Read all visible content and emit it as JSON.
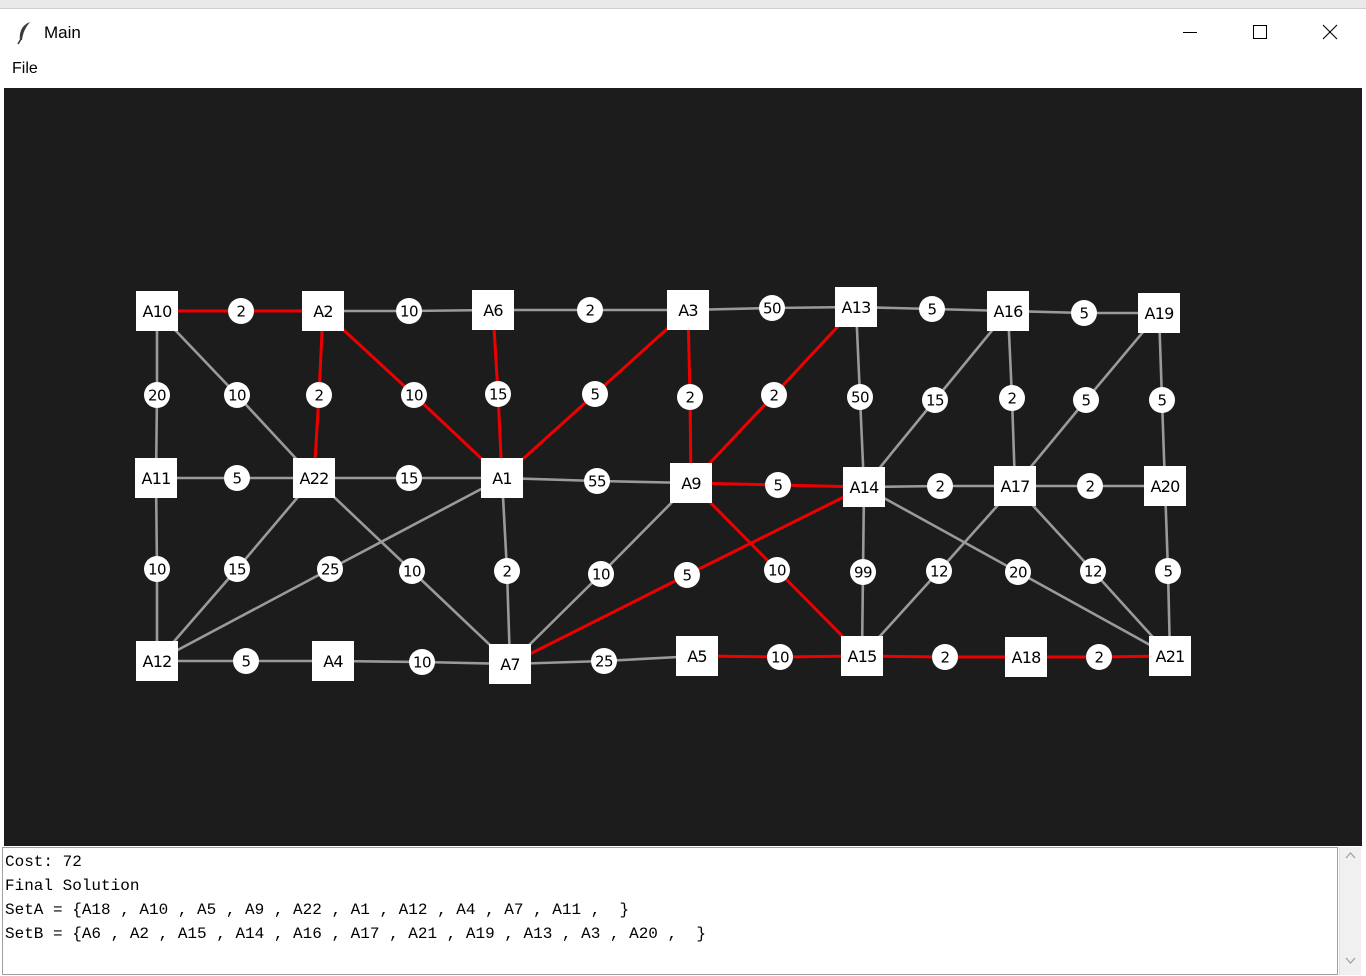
{
  "window": {
    "title": "Main"
  },
  "menu": {
    "file": "File"
  },
  "graph": {
    "nodes": [
      {
        "id": "A10"
      },
      {
        "id": "A2"
      },
      {
        "id": "A6"
      },
      {
        "id": "A3"
      },
      {
        "id": "A13"
      },
      {
        "id": "A16"
      },
      {
        "id": "A19"
      },
      {
        "id": "A11"
      },
      {
        "id": "A22"
      },
      {
        "id": "A1"
      },
      {
        "id": "A9"
      },
      {
        "id": "A14"
      },
      {
        "id": "A17"
      },
      {
        "id": "A20"
      },
      {
        "id": "A12"
      },
      {
        "id": "A4"
      },
      {
        "id": "A7"
      },
      {
        "id": "A5"
      },
      {
        "id": "A15"
      },
      {
        "id": "A18"
      },
      {
        "id": "A21"
      }
    ],
    "edges": [
      {
        "from": "A10",
        "to": "A2",
        "w": "2",
        "cut": true
      },
      {
        "from": "A2",
        "to": "A6",
        "w": "10",
        "cut": false
      },
      {
        "from": "A6",
        "to": "A3",
        "w": "2",
        "cut": false
      },
      {
        "from": "A3",
        "to": "A13",
        "w": "50",
        "cut": false
      },
      {
        "from": "A13",
        "to": "A16",
        "w": "5",
        "cut": false
      },
      {
        "from": "A16",
        "to": "A19",
        "w": "5",
        "cut": false
      },
      {
        "from": "A10",
        "to": "A11",
        "w": "20",
        "cut": false
      },
      {
        "from": "A10",
        "to": "A22",
        "w": "10",
        "cut": false
      },
      {
        "from": "A2",
        "to": "A22",
        "w": "2",
        "cut": true
      },
      {
        "from": "A2",
        "to": "A1",
        "w": "10",
        "cut": true
      },
      {
        "from": "A6",
        "to": "A1",
        "w": "15",
        "cut": true
      },
      {
        "from": "A3",
        "to": "A1",
        "w": "5",
        "cut": true
      },
      {
        "from": "A3",
        "to": "A9",
        "w": "2",
        "cut": true
      },
      {
        "from": "A13",
        "to": "A9",
        "w": "2",
        "cut": true
      },
      {
        "from": "A13",
        "to": "A14",
        "w": "50",
        "cut": false
      },
      {
        "from": "A16",
        "to": "A14",
        "w": "15",
        "cut": false
      },
      {
        "from": "A16",
        "to": "A17",
        "w": "2",
        "cut": false
      },
      {
        "from": "A19",
        "to": "A17",
        "w": "5",
        "cut": false
      },
      {
        "from": "A19",
        "to": "A20",
        "w": "5",
        "cut": false
      },
      {
        "from": "A11",
        "to": "A22",
        "w": "5",
        "cut": false
      },
      {
        "from": "A22",
        "to": "A1",
        "w": "15",
        "cut": false
      },
      {
        "from": "A1",
        "to": "A9",
        "w": "55",
        "cut": false
      },
      {
        "from": "A9",
        "to": "A14",
        "w": "5",
        "cut": true
      },
      {
        "from": "A14",
        "to": "A17",
        "w": "2",
        "cut": false
      },
      {
        "from": "A17",
        "to": "A20",
        "w": "2",
        "cut": false
      },
      {
        "from": "A11",
        "to": "A12",
        "w": "10",
        "cut": false
      },
      {
        "from": "A22",
        "to": "A12",
        "w": "15",
        "cut": false
      },
      {
        "from": "A1",
        "to": "A12",
        "w": "25",
        "cut": false
      },
      {
        "from": "A22",
        "to": "A7",
        "w": "10",
        "cut": false
      },
      {
        "from": "A1",
        "to": "A7",
        "w": "2",
        "cut": false
      },
      {
        "from": "A9",
        "to": "A7",
        "w": "10",
        "cut": false
      },
      {
        "from": "A14",
        "to": "A7",
        "w": "5",
        "cut": true
      },
      {
        "from": "A9",
        "to": "A15",
        "w": "10",
        "cut": true
      },
      {
        "from": "A14",
        "to": "A15",
        "w": "99",
        "cut": false
      },
      {
        "from": "A17",
        "to": "A15",
        "w": "12",
        "cut": false
      },
      {
        "from": "A14",
        "to": "A21",
        "w": "20",
        "cut": false
      },
      {
        "from": "A17",
        "to": "A21",
        "w": "12",
        "cut": false
      },
      {
        "from": "A20",
        "to": "A21",
        "w": "5",
        "cut": false
      },
      {
        "from": "A12",
        "to": "A4",
        "w": "5",
        "cut": false
      },
      {
        "from": "A4",
        "to": "A7",
        "w": "10",
        "cut": false
      },
      {
        "from": "A7",
        "to": "A5",
        "w": "25",
        "cut": false
      },
      {
        "from": "A5",
        "to": "A15",
        "w": "10",
        "cut": true
      },
      {
        "from": "A15",
        "to": "A18",
        "w": "2",
        "cut": true
      },
      {
        "from": "A18",
        "to": "A21",
        "w": "2",
        "cut": true
      }
    ],
    "colors": {
      "background": "#1c1c1c",
      "edge": "#9a9a9a",
      "cut_edge": "#ee0000",
      "node_fill": "#ffffff",
      "text": "#000000"
    }
  },
  "output": {
    "lines": [
      "Cost: 72",
      "Final Solution",
      "SetA = {A18 , A10 , A5 , A9 , A22 , A1 , A12 , A4 , A7 , A11 ,  }",
      "SetB = {A6 , A2 , A15 , A14 , A16 , A17 , A21 , A19 , A13 , A3 , A20 ,  }"
    ]
  },
  "icons": {
    "app": "feather-icon",
    "minimize": "minimize-icon",
    "maximize": "maximize-icon",
    "close": "close-icon"
  }
}
